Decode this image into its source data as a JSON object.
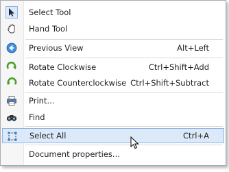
{
  "menu": {
    "items": [
      {
        "label": "Select Tool",
        "shortcut": "",
        "icon": "arrow-cursor-icon"
      },
      {
        "label": "Hand Tool",
        "shortcut": "",
        "icon": "hand-icon"
      },
      {
        "label": "Previous View",
        "shortcut": "Alt+Left",
        "icon": "back-arrow-icon"
      },
      {
        "label": "Rotate Clockwise",
        "shortcut": "Ctrl+Shift+Add",
        "icon": "rotate-clockwise-icon"
      },
      {
        "label": "Rotate Counterclockwise",
        "shortcut": "Ctrl+Shift+Subtract",
        "icon": "rotate-counterclockwise-icon"
      },
      {
        "label": "Print...",
        "shortcut": "",
        "icon": "printer-icon"
      },
      {
        "label": "Find",
        "shortcut": "",
        "icon": "binoculars-icon"
      },
      {
        "label": "Select All",
        "shortcut": "Ctrl+A",
        "icon": "select-all-icon"
      },
      {
        "label": "Document properties...",
        "shortcut": "",
        "icon": ""
      }
    ]
  },
  "colors": {
    "highlight": "#dbe9f9",
    "highlight_border": "#8fb5e3",
    "green_icon": "#4aa02c",
    "blue_icon": "#2d7bd4"
  }
}
